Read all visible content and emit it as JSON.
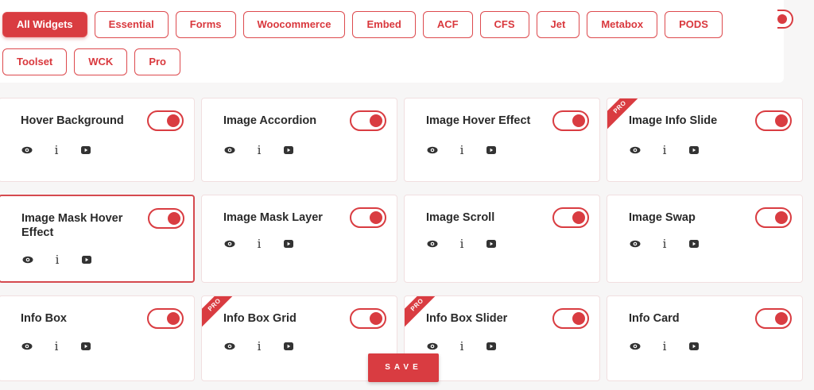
{
  "filters": {
    "row1": [
      "All Widgets",
      "Essential",
      "Forms",
      "Woocommerce",
      "Embed",
      "ACF",
      "CFS",
      "Jet",
      "Metabox",
      "PODS"
    ],
    "row2": [
      "Toolset",
      "WCK",
      "Pro"
    ],
    "active": "All Widgets"
  },
  "pro_label": "PRO",
  "widgets": [
    {
      "title": "Hover Background",
      "enabled": true,
      "pro": false
    },
    {
      "title": "Image Accordion",
      "enabled": true,
      "pro": false
    },
    {
      "title": "Image Hover Effect",
      "enabled": true,
      "pro": false
    },
    {
      "title": "Image Info Slide",
      "enabled": true,
      "pro": true
    },
    {
      "title": "Image Mask Hover Effect",
      "enabled": true,
      "pro": false
    },
    {
      "title": "Image Mask Layer",
      "enabled": true,
      "pro": false
    },
    {
      "title": "Image Scroll",
      "enabled": true,
      "pro": false
    },
    {
      "title": "Image Swap",
      "enabled": true,
      "pro": false
    },
    {
      "title": "Info Box",
      "enabled": true,
      "pro": false
    },
    {
      "title": "Info Box Grid",
      "enabled": true,
      "pro": true
    },
    {
      "title": "Info Box Slider",
      "enabled": true,
      "pro": true
    },
    {
      "title": "Info Card",
      "enabled": true,
      "pro": false
    }
  ],
  "icons": {
    "preview": "eye-icon",
    "info": "info-icon",
    "video": "youtube-icon",
    "info_glyph": "i"
  },
  "save": {
    "label": "SAVE"
  },
  "colors": {
    "accent": "#d93c41",
    "card_border": "#f1dfe0",
    "text": "#2a2a2a"
  }
}
